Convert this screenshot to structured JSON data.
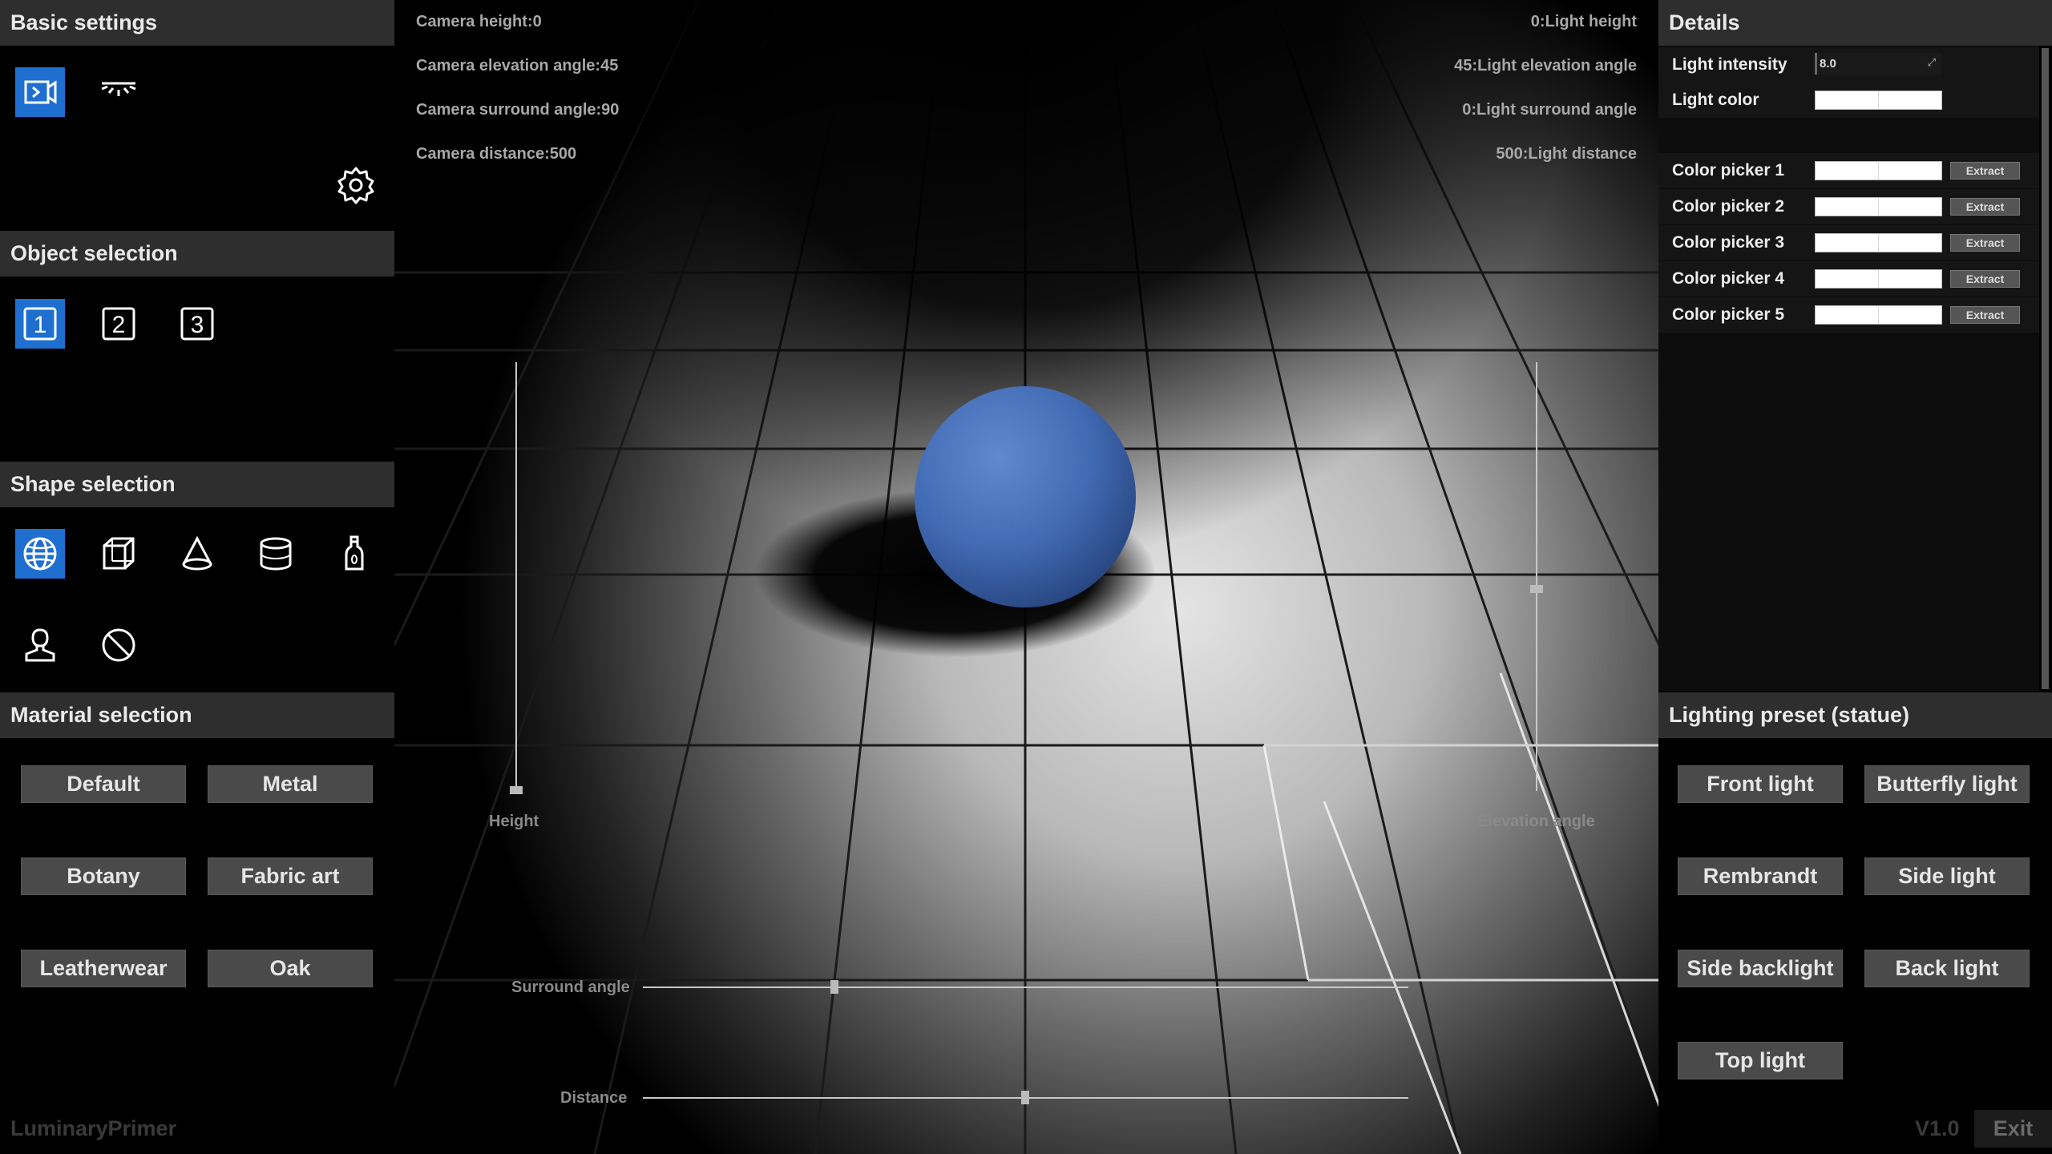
{
  "left": {
    "basic_settings": {
      "title": "Basic settings"
    },
    "object_selection": {
      "title": "Object selection",
      "items": [
        "1",
        "2",
        "3"
      ]
    },
    "shape_selection": {
      "title": "Shape selection"
    },
    "material_selection": {
      "title": "Material selection",
      "buttons": [
        "Default",
        "Metal",
        "Botany",
        "Fabric art",
        "Leatherwear",
        "Oak"
      ]
    },
    "brand": "LuminaryPrimer"
  },
  "viewport": {
    "readouts_left": [
      "Camera height:0",
      "Camera elevation angle:45",
      "Camera surround angle:90",
      "Camera distance:500"
    ],
    "readouts_right": [
      "0:Light height",
      "45:Light elevation angle",
      "0:Light surround angle",
      "500:Light distance"
    ],
    "sliders": {
      "height_label": "Height",
      "elevation_label": "Elevation angle",
      "surround_label": "Surround angle",
      "distance_label": "Distance"
    },
    "sphere_color": "#3a66b4"
  },
  "right": {
    "details": {
      "title": "Details",
      "light_intensity_label": "Light intensity",
      "light_intensity_value": "8.0",
      "light_color_label": "Light color",
      "color_pickers": [
        {
          "label": "Color picker 1",
          "button": "Extract"
        },
        {
          "label": "Color picker 2",
          "button": "Extract"
        },
        {
          "label": "Color picker 3",
          "button": "Extract"
        },
        {
          "label": "Color picker 4",
          "button": "Extract"
        },
        {
          "label": "Color picker 5",
          "button": "Extract"
        }
      ]
    },
    "lighting_preset": {
      "title": "Lighting preset (statue)",
      "buttons": [
        "Front light",
        "Butterfly light",
        "Rembrandt",
        "Side light",
        "Side backlight",
        "Back light",
        "Top light"
      ]
    },
    "version": "V1.0",
    "exit_label": "Exit"
  },
  "colors": {
    "accent": "#1e6fd0",
    "panel_header": "#2e2e2e",
    "button": "#4a4a4a"
  }
}
